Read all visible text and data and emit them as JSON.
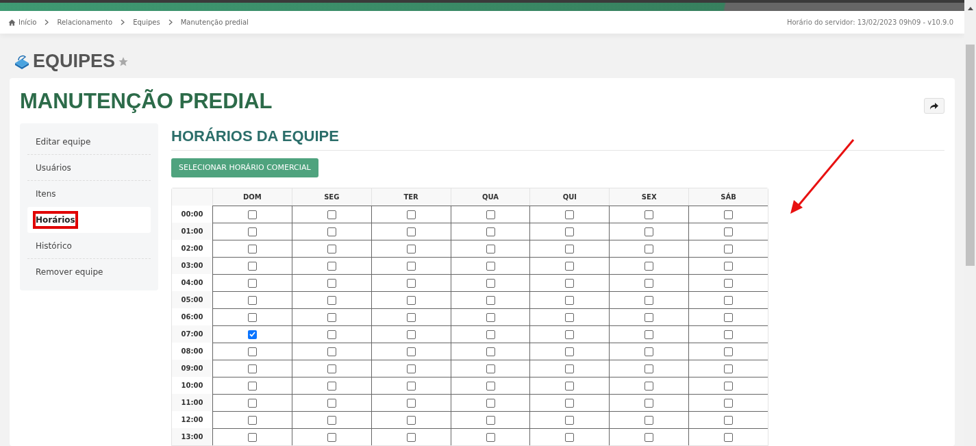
{
  "breadcrumb": [
    {
      "label": "Início",
      "kind": "home"
    },
    {
      "label": "Relacionamento",
      "kind": "link"
    },
    {
      "label": "Equipes",
      "kind": "link"
    },
    {
      "label": "Manutenção predial",
      "kind": "current"
    }
  ],
  "server_info": "Horário do servidor: 13/02/2023 09h09 - v10.9.0",
  "module": {
    "title": "EQUIPES",
    "favorite": false
  },
  "card": {
    "title": "MANUTENÇÃO PREDIAL"
  },
  "sidebar": {
    "items": [
      {
        "label": "Editar equipe",
        "selected": false,
        "annotated": false
      },
      {
        "label": "Usuários",
        "selected": false,
        "annotated": false
      },
      {
        "label": "Itens",
        "selected": false,
        "annotated": false
      },
      {
        "label": "Horários",
        "selected": true,
        "annotated": true
      },
      {
        "label": "Histórico",
        "selected": false,
        "annotated": false
      },
      {
        "label": "Remover equipe",
        "selected": false,
        "annotated": false
      }
    ]
  },
  "section": {
    "title": "HORÁRIOS DA EQUIPE",
    "button": "SELECIONAR HORÁRIO COMERCIAL"
  },
  "table": {
    "columns": [
      "DOM",
      "SEG",
      "TER",
      "QUA",
      "QUI",
      "SEX",
      "SÁB"
    ],
    "rows": [
      {
        "time": "00:00",
        "checked": [
          false,
          false,
          false,
          false,
          false,
          false,
          false
        ]
      },
      {
        "time": "01:00",
        "checked": [
          false,
          false,
          false,
          false,
          false,
          false,
          false
        ]
      },
      {
        "time": "02:00",
        "checked": [
          false,
          false,
          false,
          false,
          false,
          false,
          false
        ]
      },
      {
        "time": "03:00",
        "checked": [
          false,
          false,
          false,
          false,
          false,
          false,
          false
        ]
      },
      {
        "time": "04:00",
        "checked": [
          false,
          false,
          false,
          false,
          false,
          false,
          false
        ]
      },
      {
        "time": "05:00",
        "checked": [
          false,
          false,
          false,
          false,
          false,
          false,
          false
        ]
      },
      {
        "time": "06:00",
        "checked": [
          false,
          false,
          false,
          false,
          false,
          false,
          false
        ]
      },
      {
        "time": "07:00",
        "checked": [
          true,
          false,
          false,
          false,
          false,
          false,
          false
        ]
      },
      {
        "time": "08:00",
        "checked": [
          false,
          false,
          false,
          false,
          false,
          false,
          false
        ]
      },
      {
        "time": "09:00",
        "checked": [
          false,
          false,
          false,
          false,
          false,
          false,
          false
        ]
      },
      {
        "time": "10:00",
        "checked": [
          false,
          false,
          false,
          false,
          false,
          false,
          false
        ]
      },
      {
        "time": "11:00",
        "checked": [
          false,
          false,
          false,
          false,
          false,
          false,
          false
        ]
      },
      {
        "time": "12:00",
        "checked": [
          false,
          false,
          false,
          false,
          false,
          false,
          false
        ]
      },
      {
        "time": "13:00",
        "checked": [
          false,
          false,
          false,
          false,
          false,
          false,
          false
        ]
      }
    ]
  }
}
